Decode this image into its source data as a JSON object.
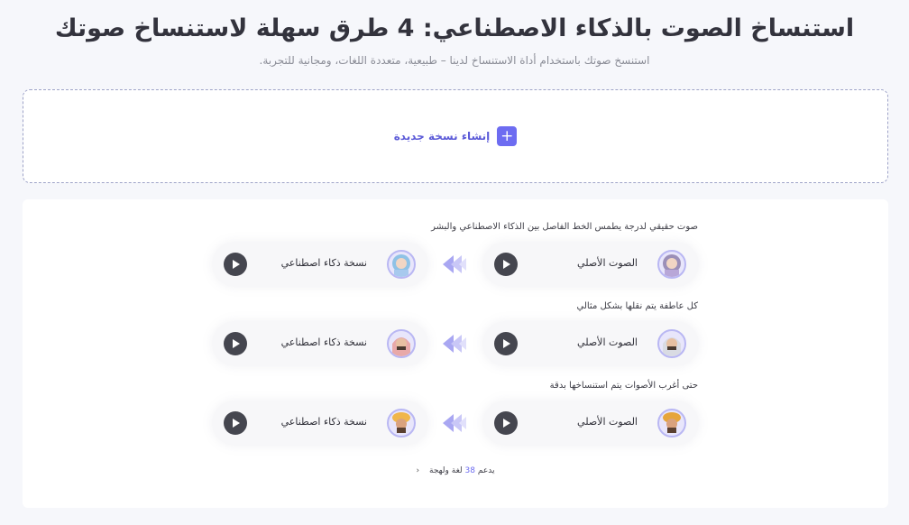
{
  "header": {
    "title": "استنساخ الصوت بالذكاء الاصطناعي: 4 طرق سهلة لاستنساخ صوتك",
    "subtitle": "استنسخ صوتك باستخدام أداة الاستنساخ لدينا – طبيعية، متعددة اللغات، ومجانية للتجربة."
  },
  "create": {
    "label": "إنشاء نسخة جديدة",
    "icon": "plus-icon",
    "accent": "#6d6cf1"
  },
  "demos": [
    {
      "caption": "صوت حقيقي لدرجة يطمس الخط الفاصل بين الذكاء الاصطناعي والبشر",
      "original_label": "الصوت الأصلي",
      "clone_label": "نسخة ذكاء اصطناعي",
      "avatar": "woman-headscarf-avatar"
    },
    {
      "caption": "كل عاطفة يتم نقلها بشكل مثالي",
      "original_label": "الصوت الأصلي",
      "clone_label": "نسخة ذكاء اصطناعي",
      "avatar": "man-keffiyeh-avatar"
    },
    {
      "caption": "حتى أغرب الأصوات يتم استنساخها بدقة",
      "original_label": "الصوت الأصلي",
      "clone_label": "نسخة ذكاء اصطناعي",
      "avatar": "man-turban-avatar"
    }
  ],
  "languages": {
    "prefix": "يدعم",
    "count": "38",
    "suffix": "لغة ولهجة"
  }
}
